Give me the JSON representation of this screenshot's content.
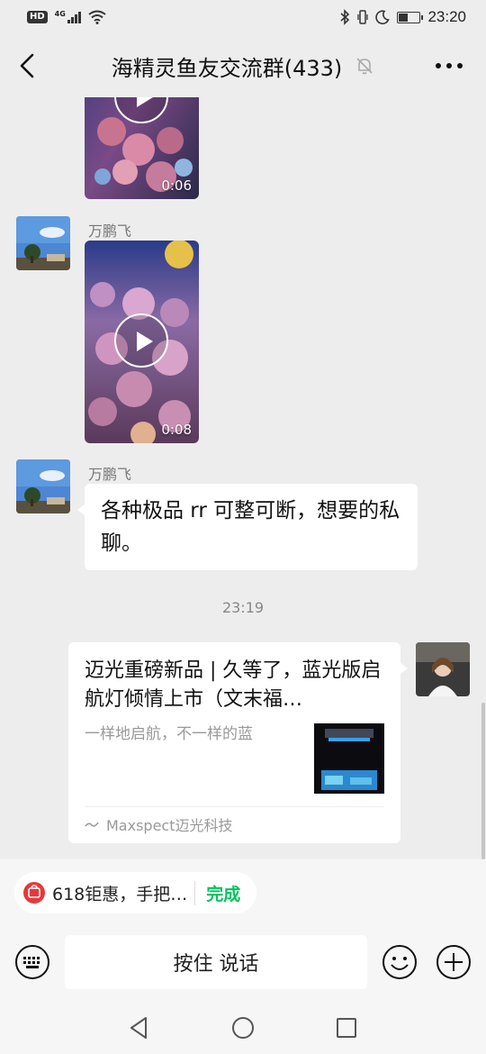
{
  "status_bar": {
    "hd_label": "HD",
    "network": "4G",
    "time": "23:20"
  },
  "header": {
    "title": "海精灵鱼友交流群(433)"
  },
  "messages": {
    "video1": {
      "duration": "0:06"
    },
    "msg2": {
      "sender": "万鹏飞",
      "duration": "0:08"
    },
    "msg3": {
      "sender": "万鹏飞",
      "text": "各种极品 rr 可整可断，想要的私聊。"
    },
    "time_separator": "23:19",
    "link": {
      "title": "迈光重磅新品 | 久等了，蓝光版启航灯倾情上市（文末福…",
      "description": "一样地启航，不一样的蓝",
      "source": "Maxspect迈光科技"
    }
  },
  "quote_bar": {
    "text": "618钜惠，手把…",
    "done_label": "完成"
  },
  "input_bar": {
    "voice_label": "按住 说话"
  },
  "colors": {
    "background": "#ededed",
    "accent_green": "#07c160",
    "bubble": "#ffffff",
    "quote_icon": "#e4393c"
  },
  "icons": [
    "back-arrow-icon",
    "mute-bell-icon",
    "more-dots-icon",
    "play-icon",
    "keyboard-icon",
    "emoji-icon",
    "plus-icon",
    "nav-back-icon",
    "nav-home-icon",
    "nav-recent-icon",
    "bluetooth-icon",
    "vibrate-icon",
    "moon-icon",
    "wifi-icon",
    "battery-icon",
    "signal-icon"
  ]
}
